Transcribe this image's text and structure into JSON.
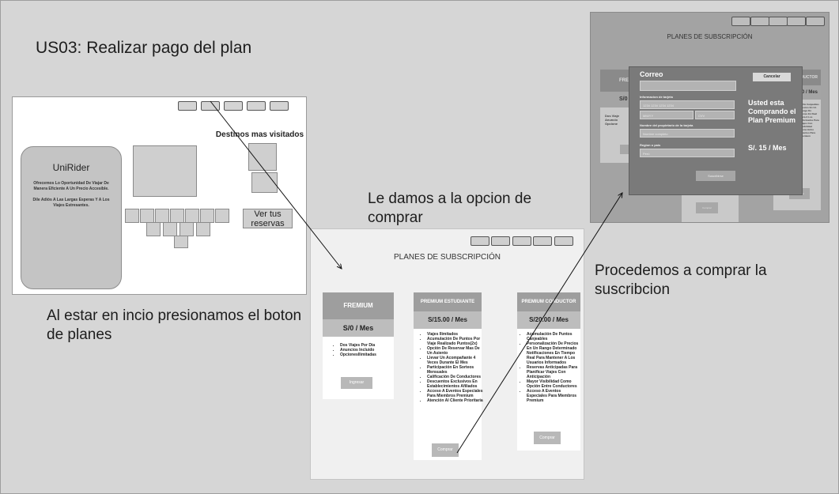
{
  "captions": {
    "title": "US03: Realizar pago del plan",
    "step1": "Al estar en incio presionamos el boton de planes",
    "step2": "Le damos a la opcion de comprar",
    "step3": "Procedemos a comprar la suscribcion"
  },
  "home": {
    "brand": "UniRider",
    "tagline": "Ofrecemos Lo Oportunidad De Viajar De Manera Eficiente A Un Precio Accesible.",
    "subtag": "Dile Adiós A Las Largas Esperas Y A Los Viajes Estresantes.",
    "section_title": "Destinos mas visitados",
    "reservas_button": "Ver tus reservas"
  },
  "plans": {
    "page_title": "PLANES DE SUBSCRIPCIÓN",
    "freemium": {
      "name": "FREMIUM",
      "price": "S/0 / Mes",
      "features": [
        "Dos Viajes Por Dia",
        "Anuncios Incluido",
        "OpcionesIlimitadas"
      ],
      "button": "Ingresar"
    },
    "student": {
      "name": "PREMIUM ESTUDIANTE",
      "price": "S/15.00 / Mes",
      "features": [
        "Viajes Ilimitados",
        "Acumulación De Puntos Por Viaje Realizado Puntos(2x)",
        "Opción De Reservar Mas De Un Asiento",
        "Llevar Un Acompañante 4 Veces Durante El Mes",
        "Participación En Sorteos Mensuales",
        "Calificación De Conductores",
        "Descuentos Exclusivos En Establecimientos Afiliados",
        "Acceso A Eventos Especiales Para Miembros Premium",
        "Atención Al Cliente Prioritaria"
      ],
      "button": "Comprar"
    },
    "driver": {
      "name": "PREMIUM CONDUCTOR",
      "price": "S/20.00 / Mes",
      "features": [
        "Acumulación De Puntos Canjeables",
        "Personalización De Precios En Un Rango Determinado",
        "Notificaciones En Tiempo Real Para Mantener A Los Usuarios Informados",
        "Reservas Anticipadas Para Planificar Viajes Con Anticipación",
        "Mayor Visibilidad Como Opción Entre Conductores",
        "Acceso A Eventos Especiales Para Miembros Premium"
      ],
      "button": "Comprar"
    }
  },
  "purchase": {
    "page_title": "PLANES DE SUBSCRIPCIÓN",
    "bg_left_head": "FRE",
    "bg_left_price": "S/0",
    "bg_right_head": "CONDUCTOR",
    "bg_right_price": "0.00 / Mes",
    "bg_left_features": [
      "Dos Viaje",
      "Anuncio",
      "Opcione"
    ],
    "bg_right_features": "... De Canjeables Precios En Un Rango Do Hones En Real Para A Los Informados Para Viajes Con Visibilidad Como Entre Eventos Para Premium",
    "bg_mid_text": "Prioritaria",
    "bg_mid_button": "Comprar",
    "bg_right_button": "Comprar",
    "modal": {
      "email_label": "Correo",
      "cancel_button": "Cancelar",
      "card_label": "Informacion de tarjeta",
      "card_placeholder": "1234 1234 1234 1234",
      "expiry_placeholder": "MM/YY",
      "cvv_placeholder": "CVV",
      "owner_label": "Nombre del propietario de la tarjeta",
      "owner_placeholder": "Nombre completo",
      "region_label": "Region o país",
      "region_value": "Perú",
      "submit_button": "Suscribirse",
      "summary": "Usted esta Comprando el Plan Premium",
      "price": "S/. 15 / Mes"
    }
  }
}
